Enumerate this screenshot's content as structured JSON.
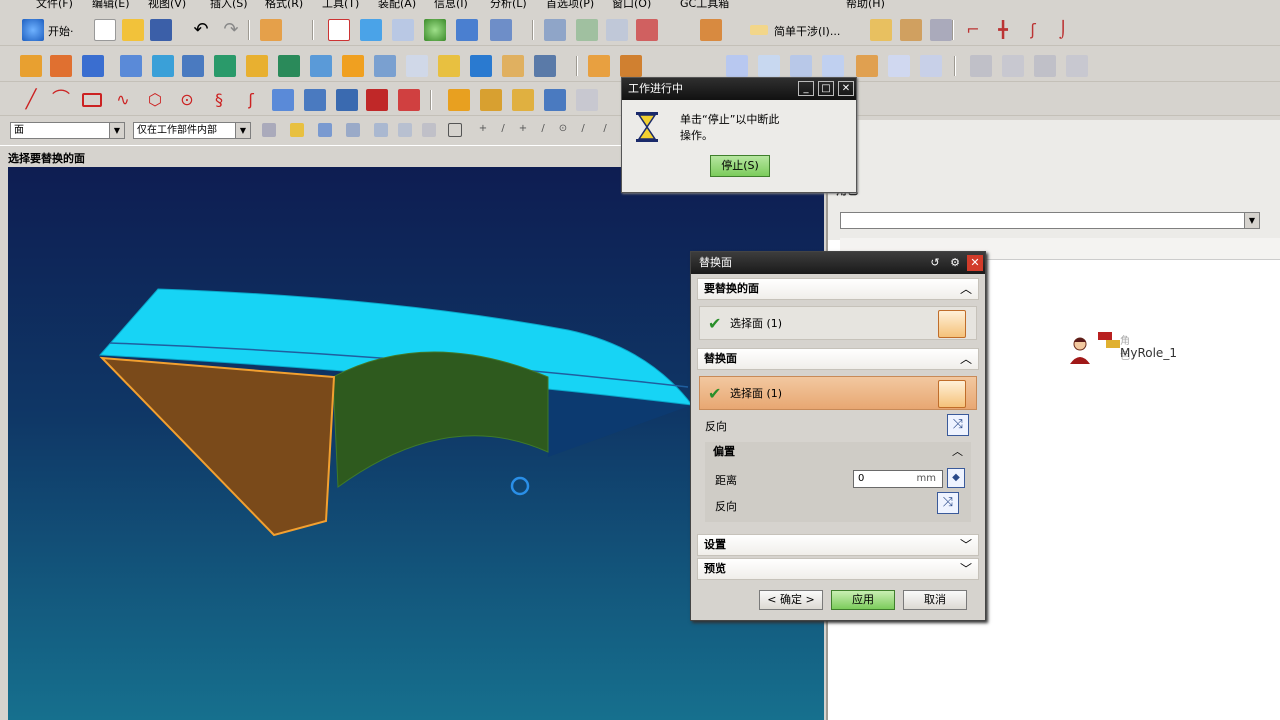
{
  "menubar": {
    "items": [
      "文件(F)",
      "编辑(E)",
      "视图(V)",
      "插入(S)",
      "格式(R)",
      "工具(T)",
      "装配(A)",
      "信息(I)",
      "分析(L)",
      "首选项(P)",
      "窗口(O)",
      "GC工具箱",
      "帮助(H)"
    ]
  },
  "toolbar1": {
    "start_label": "开始·",
    "simple_interference_label": "简单干涉(I)..."
  },
  "selection_bar": {
    "filter_type": "面",
    "scope": "仅在工作部件内部"
  },
  "statusbar": {
    "prompt": "选择要替换的面"
  },
  "progress_dialog": {
    "title": "工作进行中",
    "message": "单击“停止”以中断此操作。",
    "stop_button": "停止(S)"
  },
  "replace_face_dialog": {
    "title": "替换面",
    "section_face_to_replace": "要替换的面",
    "select_face_1": "选择面 (1)",
    "section_replacement_face": "替换面",
    "select_face_2": "选择面 (1)",
    "reverse_direction": "反向",
    "offset_group": "偏置",
    "distance_label": "距离",
    "distance_value": "0",
    "distance_unit": "mm",
    "offset_reverse": "反向",
    "section_settings": "设置",
    "section_preview": "预览",
    "ok_button": "< 确定 >",
    "apply_button": "应用",
    "cancel_button": "取消"
  },
  "right_panel": {
    "title": "角色",
    "role_small_label": "角色",
    "role_name": "MyRole_1"
  },
  "colors": {
    "viewport_top": "#0e1d52",
    "viewport_bottom": "#16708e",
    "apply_green": "#7ccc5c",
    "selected_row": "#e8a772",
    "cyan_face": "#17d4f5",
    "brown_face": "#7a4a1a",
    "green_face": "#2e5a1e"
  }
}
